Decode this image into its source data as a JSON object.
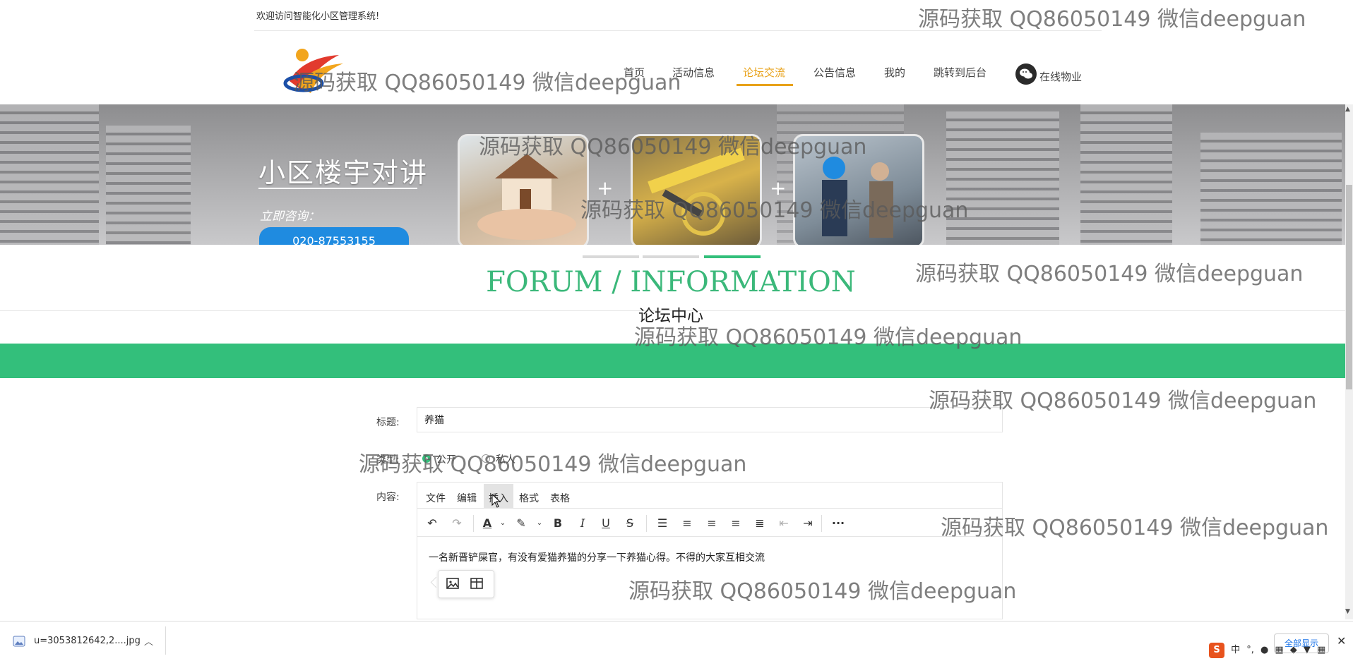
{
  "header": {
    "welcome": "欢迎访问智能化小区管理系统!",
    "nav": [
      "首页",
      "活动信息",
      "论坛交流",
      "公告信息",
      "我的",
      "跳转到后台"
    ],
    "active_nav": "论坛交流",
    "online_service": "在线物业",
    "accent": "#e8a21a"
  },
  "banner": {
    "title": "小区楼宇对讲",
    "consult": "立即咨询：",
    "phone": "020-87553155"
  },
  "section": {
    "title_en": "FORUM / INFORMATION",
    "title_cn": "论坛中心",
    "accent": "#33bf7b"
  },
  "form": {
    "title_label": "标题:",
    "title_value": "养猫",
    "type_label": "类型:",
    "type_options": [
      "公开",
      "私人"
    ],
    "type_selected": "公开",
    "content_label": "内容:",
    "editor_menu": [
      "文件",
      "编辑",
      "插入",
      "格式",
      "表格"
    ],
    "editor_menu_hover": "插入",
    "editor_text": "一名新晋铲屎官，有没有爱猫养猫的分享一下养猫心得。不得的大家互相交流",
    "toolbar_icons": [
      "undo-icon",
      "redo-icon",
      "font-color-icon",
      "highlight-icon",
      "bold-icon",
      "italic-icon",
      "underline-icon",
      "strikethrough-icon",
      "line-height-icon",
      "align-left-icon",
      "align-center-icon",
      "align-right-icon",
      "align-justify-icon",
      "outdent-icon",
      "indent-icon",
      "more-icon"
    ],
    "quick_insert_icons": [
      "image-icon",
      "table-icon"
    ]
  },
  "watermark": "源码获取 QQ86050149 微信deepguan",
  "download_bar": {
    "file_name": "u=3053812642,2....jpg",
    "show_all": "全部显示",
    "close": "✕"
  }
}
